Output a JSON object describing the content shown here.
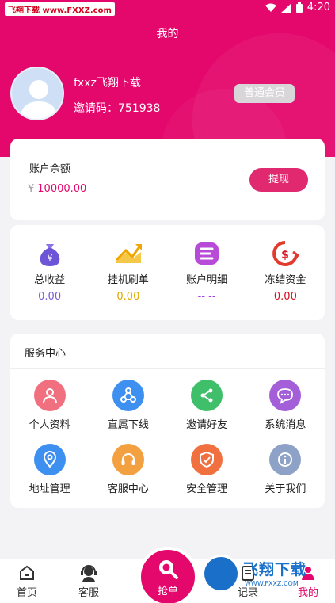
{
  "status_bar": {
    "watermark": "飞翔下载 www.FXXZ.com",
    "time": "4:20"
  },
  "header": {
    "title": "我的",
    "username": "fxxz飞翔下载",
    "invite_label": "邀请码：",
    "invite_code": "751938",
    "member_level": "普通会员"
  },
  "balance": {
    "label": "账户余额",
    "currency": "¥",
    "amount": "10000.00",
    "withdraw_label": "提现"
  },
  "stats": [
    {
      "label": "总收益",
      "value": "0.00",
      "color": "#7b5cd6",
      "icon": "money-bag-icon"
    },
    {
      "label": "挂机刷单",
      "value": "0.00",
      "color": "#e0a800",
      "icon": "trend-up-icon"
    },
    {
      "label": "账户明细",
      "value": "-- --",
      "color": "#a53fe2",
      "icon": "detail-icon"
    },
    {
      "label": "冻结资金",
      "value": "0.00",
      "color": "#d8101d",
      "icon": "frozen-funds-icon"
    }
  ],
  "services": {
    "title": "服务中心",
    "items": [
      {
        "label": "个人资料",
        "icon": "person-icon",
        "color": "#f07080"
      },
      {
        "label": "直属下线",
        "icon": "network-icon",
        "color": "#3d8ff0"
      },
      {
        "label": "邀请好友",
        "icon": "share-icon",
        "color": "#3fbf6a"
      },
      {
        "label": "系统消息",
        "icon": "message-icon",
        "color": "#a45ed8"
      },
      {
        "label": "地址管理",
        "icon": "location-icon",
        "color": "#3d8ff0"
      },
      {
        "label": "客服中心",
        "icon": "headset-icon",
        "color": "#f3a140"
      },
      {
        "label": "安全管理",
        "icon": "shield-icon",
        "color": "#f07040"
      },
      {
        "label": "关于我们",
        "icon": "info-icon",
        "color": "#8da2c6"
      }
    ]
  },
  "nav": {
    "home": "首页",
    "service": "客服",
    "grab": "抢单",
    "records": "记录",
    "mine": "我的",
    "active_color": "#e4086c"
  },
  "watermark_logo": {
    "text": "飞翔下载",
    "sub": "WWW.FXXZ.COM"
  }
}
